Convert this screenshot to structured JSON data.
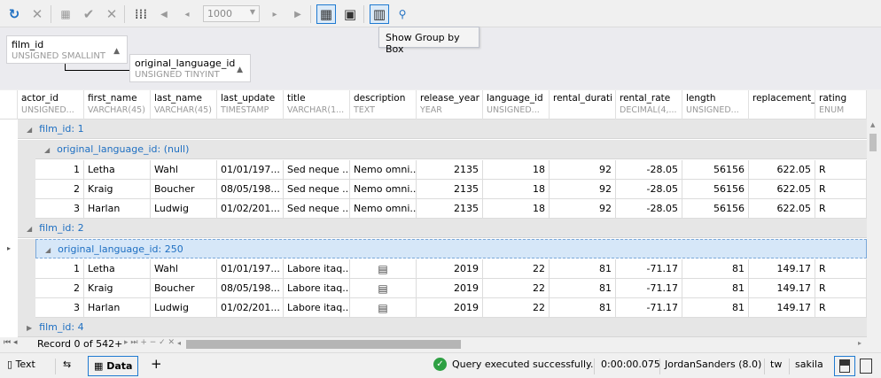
{
  "toolbar": {
    "page_size": "1000",
    "tooltip": "Show Group by Box"
  },
  "group_by": [
    {
      "name": "film_id",
      "type": "UNSIGNED SMALLINT"
    },
    {
      "name": "original_language_id",
      "type": "UNSIGNED TINYINT"
    }
  ],
  "columns": [
    {
      "name": "actor_id",
      "type": "UNSIGNED..."
    },
    {
      "name": "first_name",
      "type": "VARCHAR(45)"
    },
    {
      "name": "last_name",
      "type": "VARCHAR(45)"
    },
    {
      "name": "last_update",
      "type": "TIMESTAMP"
    },
    {
      "name": "title",
      "type": "VARCHAR(1..."
    },
    {
      "name": "description",
      "type": "TEXT"
    },
    {
      "name": "release_year",
      "type": "YEAR"
    },
    {
      "name": "language_id",
      "type": "UNSIGNED..."
    },
    {
      "name": "rental_durati on",
      "type": ""
    },
    {
      "name": "rental_rate",
      "type": "DECIMAL(4,..."
    },
    {
      "name": "length",
      "type": "UNSIGNED..."
    },
    {
      "name": "replacement_ cost",
      "type": ""
    },
    {
      "name": "rating",
      "type": "ENUM"
    }
  ],
  "groups": [
    {
      "label": "film_id: 1",
      "sub": [
        {
          "label": "original_language_id: (null)",
          "rows": [
            [
              "1",
              "Letha",
              "Wahl",
              "01/01/197...",
              "Sed neque ...",
              "Nemo omni...",
              "2135",
              "18",
              "92",
              "-28.05",
              "56156",
              "622.05",
              "R"
            ],
            [
              "2",
              "Kraig",
              "Boucher",
              "08/05/198...",
              "Sed neque ...",
              "Nemo omni...",
              "2135",
              "18",
              "92",
              "-28.05",
              "56156",
              "622.05",
              "R"
            ],
            [
              "3",
              "Harlan",
              "Ludwig",
              "01/02/201...",
              "Sed neque ...",
              "Nemo omni...",
              "2135",
              "18",
              "92",
              "-28.05",
              "56156",
              "622.05",
              "R"
            ]
          ]
        }
      ]
    },
    {
      "label": "film_id: 2",
      "sub": [
        {
          "label": "original_language_id: 250",
          "rows": [
            [
              "1",
              "Letha",
              "Wahl",
              "01/01/197...",
              "Labore itaq...",
              "memo-icon",
              "2019",
              "22",
              "81",
              "-71.17",
              "81",
              "149.17",
              "R"
            ],
            [
              "2",
              "Kraig",
              "Boucher",
              "08/05/198...",
              "Labore itaq...",
              "memo-icon",
              "2019",
              "22",
              "81",
              "-71.17",
              "81",
              "149.17",
              "R"
            ],
            [
              "3",
              "Harlan",
              "Ludwig",
              "01/02/201...",
              "Labore itaq...",
              "memo-icon",
              "2019",
              "22",
              "81",
              "-71.17",
              "81",
              "149.17",
              "R"
            ]
          ]
        }
      ]
    },
    {
      "label": "film_id: 4",
      "sub": []
    }
  ],
  "navigator": {
    "record": "Record 0 of 542+"
  },
  "status": {
    "text_tab": "Text",
    "data_tab": "Data",
    "message": "Query executed successfully.",
    "duration": "0:00:00.075",
    "user": "JordanSanders (8.0)",
    "host": "tw",
    "database": "sakila"
  }
}
